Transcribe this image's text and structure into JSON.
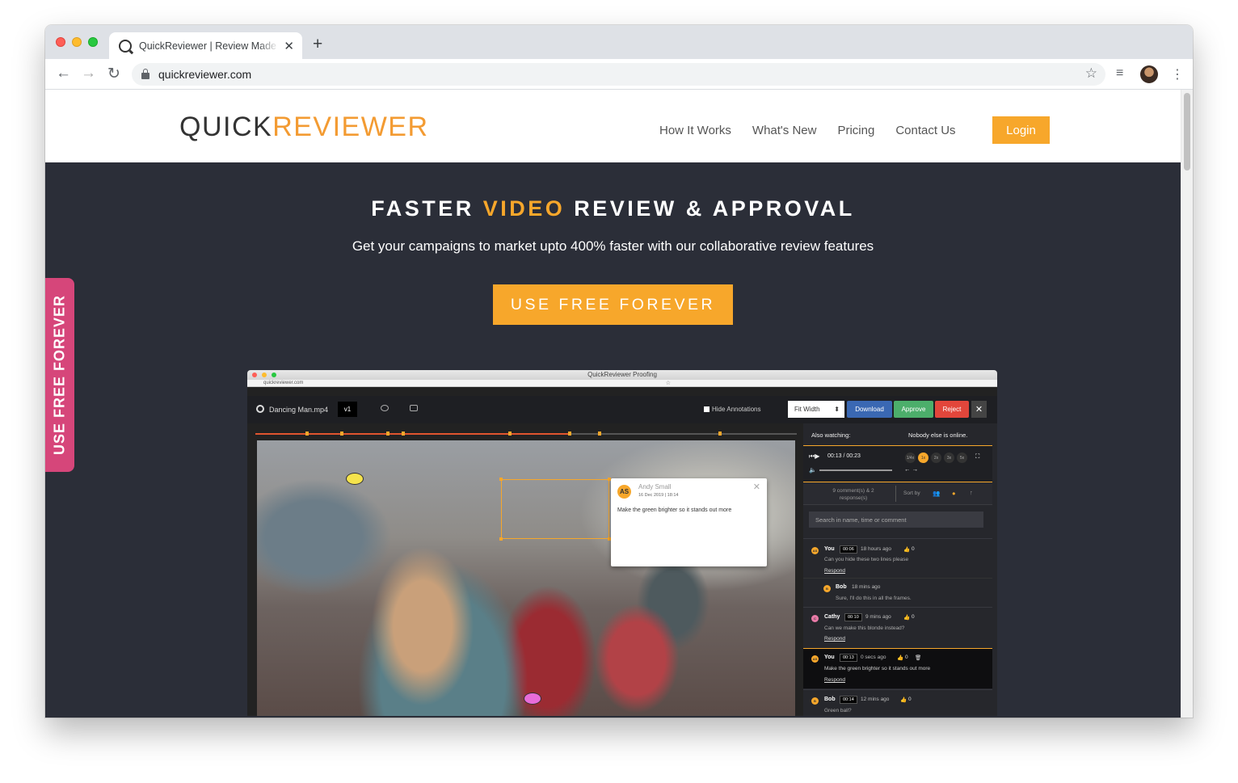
{
  "browser": {
    "tab_title": "QuickReviewer | Review Made Easy",
    "url": "quickreviewer.com",
    "new_tab_symbol": "+",
    "close_symbol": "✕",
    "icons": {
      "back": "arrow-left-icon",
      "forward": "arrow-right-icon",
      "reload": "reload-icon",
      "star": "star-icon",
      "media": "media-control-icon",
      "menu": "kebab-menu-icon"
    }
  },
  "site": {
    "logo_quick": "QUICK",
    "logo_reviewer": "REVIEWER",
    "nav": [
      "How It Works",
      "What's New",
      "Pricing",
      "Contact Us"
    ],
    "login": "Login",
    "accent_color": "#f7a72b",
    "side_cta_color": "#d6467a"
  },
  "hero": {
    "title_pre": "FASTER ",
    "title_accent": "VIDEO",
    "title_post": " REVIEW & APPROVAL",
    "subtitle": "Get your campaigns to market upto 400% faster with our collaborative review features",
    "cta": "USE FREE FOREVER",
    "side_cta": "USE FREE FOREVER"
  },
  "app": {
    "window_title": "QuickReviewer Proofing",
    "url": "quickreviewer.com",
    "file_name": "Dancing Man.mp4",
    "version": "v1",
    "hide_annotations": "Hide Annotations",
    "fit_width": "Fit Width",
    "download": "Download",
    "approve": "Approve",
    "reject": "Reject",
    "close": "✕",
    "colors": {
      "download": "#3a68b3",
      "approve": "#4cae6b",
      "reject": "#e2463b"
    },
    "popup": {
      "initials": "AS",
      "name": "Andy Small",
      "date": "16 Dec 2019 | 18:14",
      "text": "Make the green brighter so it stands out more",
      "close": "✕"
    },
    "panel": {
      "also_watching": "Also watching:",
      "nobody_online": "Nobody else is online.",
      "time": "00:13 / 00:23",
      "speeds": [
        "1/4x",
        "1x",
        "2x",
        "3x",
        "5x"
      ],
      "comment_count": "9 comment(s) & 2 response(s)",
      "sort_by": "Sort by",
      "search_placeholder": "Search in name, time or comment",
      "respond": "Respond",
      "comments": [
        {
          "initials": "AS",
          "who": "You",
          "tc": "00:06",
          "ago": "18 hours ago",
          "likes": "0",
          "body": "Can you hide these two lines please",
          "color": "#f7a72b"
        },
        {
          "initials": "B",
          "who": "Bob",
          "tc": "",
          "ago": "18 mins ago",
          "likes": "",
          "body": "Sure, I'll do this in all the frames.",
          "color": "#f7a72b"
        },
        {
          "initials": "C",
          "who": "Cathy",
          "tc": "00:10",
          "ago": "9 mins ago",
          "likes": "0",
          "body": "Can we make this blonde instead?",
          "color": "#e87aa7"
        },
        {
          "initials": "AS",
          "who": "You",
          "tc": "00:13",
          "ago": "0 secs ago",
          "likes": "0",
          "body": "Make the green brighter so it stands out more",
          "color": "#f7a72b"
        },
        {
          "initials": "B",
          "who": "Bob",
          "tc": "00:14",
          "ago": "12 mins ago",
          "likes": "0",
          "body": "Green ball?",
          "color": "#f7a72b"
        }
      ]
    }
  }
}
